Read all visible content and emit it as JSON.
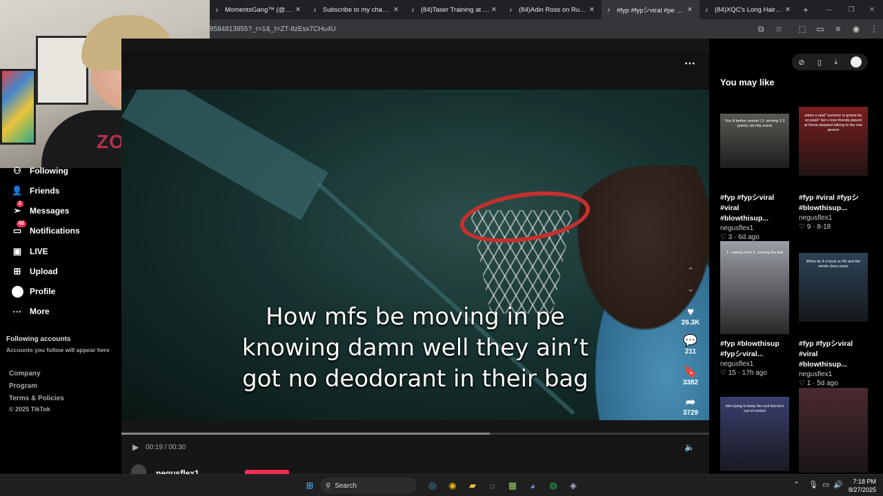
{
  "browser": {
    "tabs": [
      {
        "label": "MomentsGang™ (@moms",
        "icon": "music-note-icon"
      },
      {
        "label": "Subscribe to my channel g",
        "icon": "tiktok-icon"
      },
      {
        "label": "(84)Taser Training at Jeffe",
        "icon": "tiktok-icon"
      },
      {
        "label": "(84)Adin Ross on Rust loo",
        "icon": "tiktok-icon"
      },
      {
        "label": "#fyp #fypシviral #pe #blo",
        "icon": "tiktok-icon",
        "active": true
      },
      {
        "label": "(84)XQC's Long Hair: The",
        "icon": "tiktok-icon"
      }
    ],
    "url": "8584813855?_r=1&_t=ZT-8zEsx7CHu4U"
  },
  "webcam": {
    "shirt_text": "ZOVKIV"
  },
  "sidebar": {
    "following": "Following",
    "friends": "Friends",
    "messages": "Messages",
    "messages_badge": "2",
    "notifications": "Notifications",
    "notifications_badge": "82",
    "live": "LIVE",
    "upload": "Upload",
    "profile": "Profile",
    "more": "More",
    "following_accounts_title": "Following accounts",
    "following_accounts_note": "Accounts you follow will appear here",
    "footer": [
      "Company",
      "Program",
      "Terms & Policies",
      "© 2025 TikTok"
    ]
  },
  "video": {
    "caption_lines": [
      "How mfs be moving in pe",
      "knowing damn well they ain’t",
      "got no deodorant in their bag"
    ],
    "likes": "26.3K",
    "comments": "211",
    "saves": "3382",
    "shares": "3729",
    "time": "00:19 / 00:30",
    "progress": 0.627,
    "author": "negusflex1"
  },
  "right_panel": {
    "title": "You may like",
    "cards": [
      {
        "title_line1": "#fyp #fypシviral",
        "title_line2": "#viral #blowthisup...",
        "author": "negusflex1",
        "likes": "3",
        "age": "6d ago",
        "thumb_text": "You ill before events | 3. serving 3 3 points; win the event",
        "thumb_color": "#5a5a55"
      },
      {
        "title_line1": "#fyp #viral #fypシ",
        "title_line2": "#blowthisup...",
        "author": "negusflex1",
        "likes": "9",
        "age": "8-18",
        "thumb_text": "when u said \"summer is gonna be so peak\" but u loss friends,stayed at home,stopped talking to the one person",
        "thumb_color": "#7a1f22"
      },
      {
        "title_line1": "#fyp #blowthisup",
        "title_line2": "#fypシviral...",
        "author": "negusflex1",
        "likes": "15",
        "age": "17h ago",
        "thumb_text": "1 - eating chick 2. running the ball",
        "thumb_color": "#9b9ea6"
      },
      {
        "title_line1": "#fyp #fypシviral",
        "title_line2": "#viral #blowthisup...",
        "author": "negusflex1",
        "likes": "1",
        "age": "5d ago",
        "thumb_text": "When its 4 o'clock in PE and the whole class starts",
        "thumb_color": "#2d4256"
      },
      {
        "title_line1": "",
        "title_line2": "",
        "author": "",
        "likes": "",
        "age": "",
        "thumb_text": "him trying to keep his cool but he's out of control",
        "thumb_color": "#3a3f6e"
      },
      {
        "title_line1": "",
        "title_line2": "",
        "author": "",
        "likes": "",
        "age": "",
        "thumb_text": "",
        "thumb_color": "#4a2a2f"
      }
    ]
  },
  "taskbar": {
    "search_label": "Search",
    "time": "7:18 PM",
    "date": "8/27/2025"
  }
}
